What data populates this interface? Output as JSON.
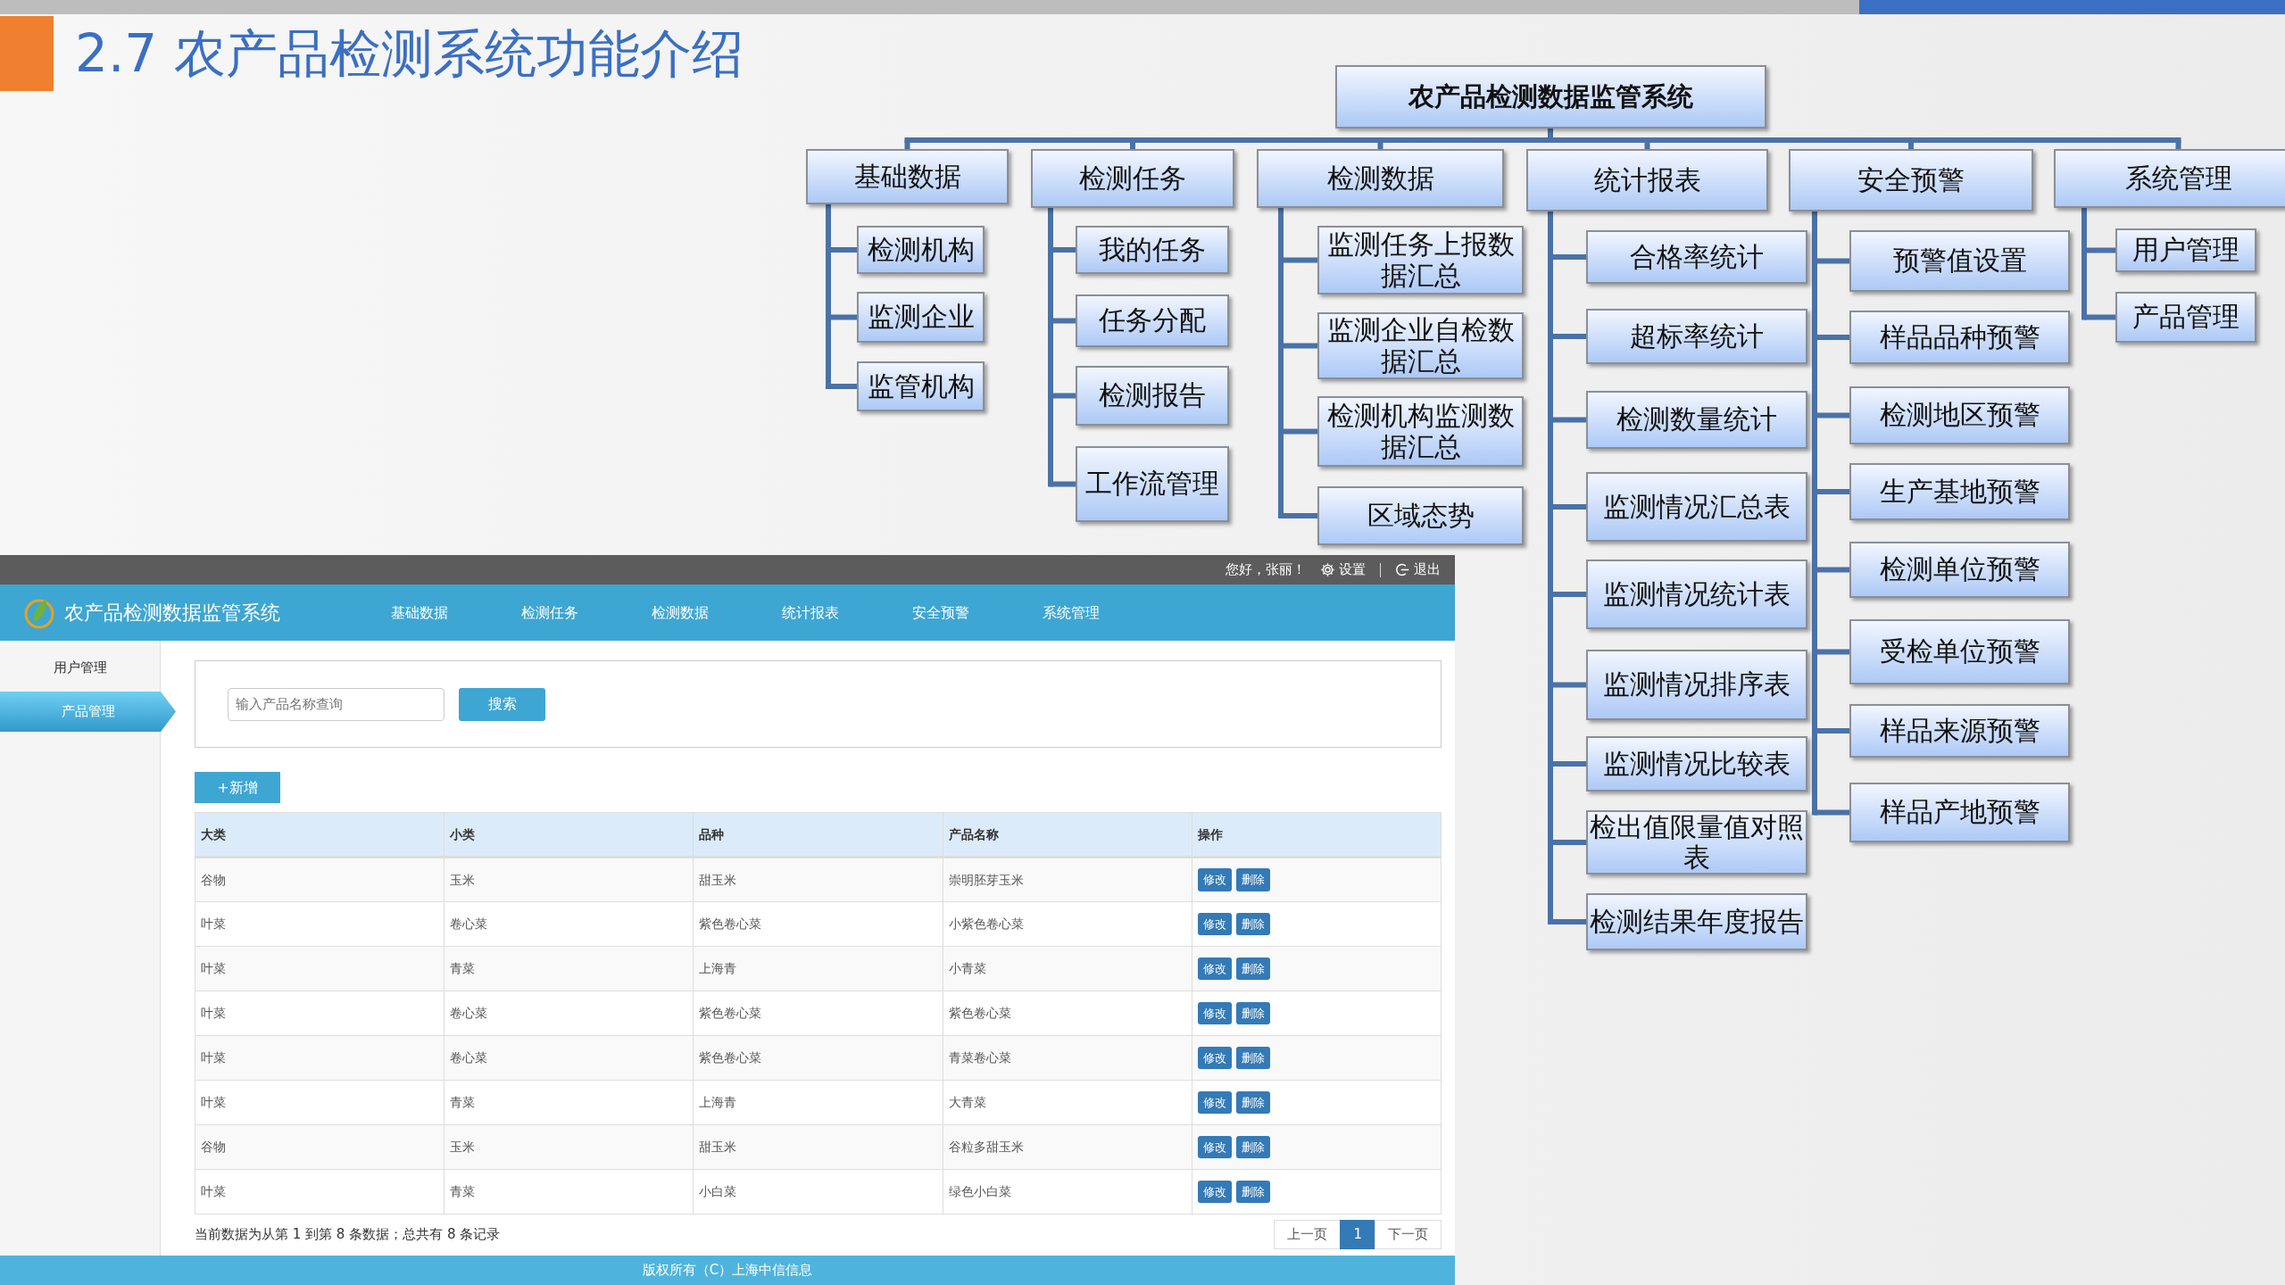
{
  "slide_title": "2.7 农产品检测系统功能介绍",
  "org_chart": {
    "root": "农产品检测数据监管系统",
    "branches": [
      {
        "label": "基础数据",
        "children": [
          {
            "label": "检测机构"
          },
          {
            "label": "监测企业"
          },
          {
            "label": "监管机构"
          }
        ]
      },
      {
        "label": "检测任务",
        "children": [
          {
            "label": "我的任务"
          },
          {
            "label": "任务分配"
          },
          {
            "label": "检测报告"
          },
          {
            "label": "工作流管理"
          }
        ]
      },
      {
        "label": "检测数据",
        "children": [
          {
            "label": "监测任务上报数据汇总"
          },
          {
            "label": "监测企业自检数据汇总"
          },
          {
            "label": "检测机构监测数据汇总"
          },
          {
            "label": "区域态势"
          }
        ]
      },
      {
        "label": "统计报表",
        "children": [
          {
            "label": "合格率统计"
          },
          {
            "label": "超标率统计"
          },
          {
            "label": "检测数量统计"
          },
          {
            "label": "监测情况汇总表"
          },
          {
            "label": "监测情况统计表"
          },
          {
            "label": "监测情况排序表"
          },
          {
            "label": "监测情况比较表"
          },
          {
            "label": "检出值限量值对照表"
          },
          {
            "label": "检测结果年度报告"
          }
        ]
      },
      {
        "label": "安全预警",
        "children": [
          {
            "label": "预警值设置"
          },
          {
            "label": "样品品种预警"
          },
          {
            "label": "检测地区预警"
          },
          {
            "label": "生产基地预警"
          },
          {
            "label": "检测单位预警"
          },
          {
            "label": "受检单位预警"
          },
          {
            "label": "样品来源预警"
          },
          {
            "label": "样品产地预警"
          }
        ]
      },
      {
        "label": "系统管理",
        "children": [
          {
            "label": "用户管理"
          },
          {
            "label": "产品管理"
          }
        ]
      }
    ]
  },
  "app": {
    "top_bar": {
      "greeting": "您好，张丽！",
      "settings": "设置",
      "logout": "退出"
    },
    "app_title": "农产品检测数据监管系统",
    "nav": [
      "基础数据",
      "检测任务",
      "检测数据",
      "统计报表",
      "安全预警",
      "系统管理"
    ],
    "sidebar": {
      "items": [
        {
          "label": "用户管理",
          "selected": false
        },
        {
          "label": "产品管理",
          "selected": true
        }
      ]
    },
    "search": {
      "placeholder": "输入产品名称查询",
      "button": "搜索"
    },
    "add_button": "+新增",
    "table": {
      "columns": [
        "大类",
        "小类",
        "品种",
        "产品名称",
        "操作"
      ],
      "rows": [
        {
          "cells": [
            "谷物",
            "玉米",
            "甜玉米",
            "崇明胚芽玉米"
          ],
          "actions": [
            "修改",
            "删除"
          ]
        },
        {
          "cells": [
            "叶菜",
            "卷心菜",
            "紫色卷心菜",
            "小紫色卷心菜"
          ],
          "actions": [
            "修改",
            "删除"
          ]
        },
        {
          "cells": [
            "叶菜",
            "青菜",
            "上海青",
            "小青菜"
          ],
          "actions": [
            "修改",
            "删除"
          ]
        },
        {
          "cells": [
            "叶菜",
            "卷心菜",
            "紫色卷心菜",
            "紫色卷心菜"
          ],
          "actions": [
            "修改",
            "删除"
          ]
        },
        {
          "cells": [
            "叶菜",
            "卷心菜",
            "紫色卷心菜",
            "青菜卷心菜"
          ],
          "actions": [
            "修改",
            "删除"
          ]
        },
        {
          "cells": [
            "叶菜",
            "青菜",
            "上海青",
            "大青菜"
          ],
          "actions": [
            "修改",
            "删除"
          ]
        },
        {
          "cells": [
            "谷物",
            "玉米",
            "甜玉米",
            "谷粒多甜玉米"
          ],
          "actions": [
            "修改",
            "删除"
          ]
        },
        {
          "cells": [
            "叶菜",
            "青菜",
            "小白菜",
            "绿色小白菜"
          ],
          "actions": [
            "修改",
            "删除"
          ]
        }
      ]
    },
    "summary": "当前数据为从第 1 到第 8 条数据；总共有 8 条记录",
    "pagination": [
      {
        "label": "上一页",
        "selected": false
      },
      {
        "label": "1",
        "selected": true
      },
      {
        "label": "下一页",
        "selected": false
      }
    ],
    "footer": "版权所有（C）上海中信信息"
  }
}
